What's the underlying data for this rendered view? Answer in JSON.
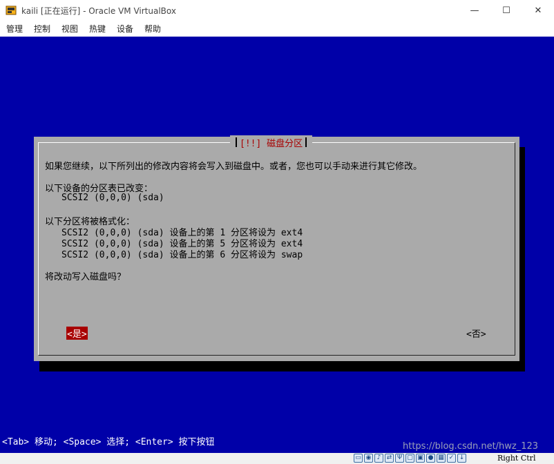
{
  "window": {
    "title": "kaili [正在运行] - Oracle VM VirtualBox",
    "controls": {
      "minimize": "—",
      "maximize": "☐",
      "close": "✕"
    }
  },
  "menu": {
    "items": [
      "管理",
      "控制",
      "视图",
      "热键",
      "设备",
      "帮助"
    ]
  },
  "dialog": {
    "title": "[!!] 磁盘分区",
    "intro": "如果您继续，以下所列出的修改内容将会写入到磁盘中。或者，您也可以手动来进行其它修改。",
    "table_heading": "以下设备的分区表已改变：",
    "table_device": "SCSI2 (0,0,0) (sda)",
    "format_heading": "以下分区将被格式化：",
    "format_lines": [
      "SCSI2 (0,0,0) (sda) 设备上的第 1 分区将设为 ext4",
      "SCSI2 (0,0,0) (sda) 设备上的第 5 分区将设为 ext4",
      "SCSI2 (0,0,0) (sda) 设备上的第 6 分区将设为 swap"
    ],
    "question": "将改动写入磁盘吗？",
    "yes_label": "<是>",
    "no_label": "<否>"
  },
  "help_line": "<Tab> 移动; <Space> 选择; <Enter> 按下按钮",
  "watermark": "https://blog.csdn.net/hwz_123",
  "statusbar": {
    "icons": [
      "hdd-icon",
      "optical-icon",
      "audio-icon",
      "network-icon",
      "usb-icon",
      "shared-folder-icon",
      "display-icon",
      "recording-icon",
      "cpu-icon",
      "mouse-integration-icon",
      "arrow-down-icon"
    ],
    "host_key": "Right Ctrl"
  }
}
